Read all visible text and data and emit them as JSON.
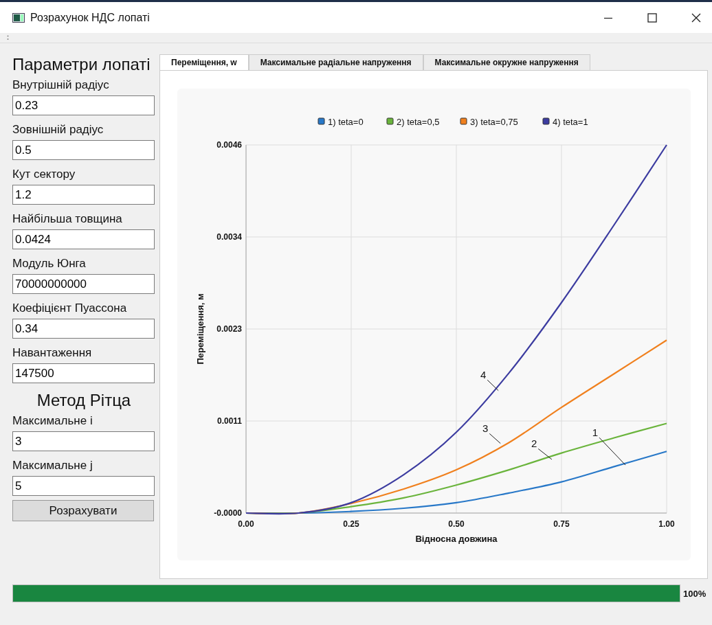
{
  "window": {
    "title": "Розрахунок НДС лопаті"
  },
  "left_panel": {
    "heading": "Параметри лопаті",
    "fields": [
      {
        "label": "Внутрішній радіус",
        "value": "0.23"
      },
      {
        "label": "Зовнішній радіус",
        "value": "0.5"
      },
      {
        "label": "Кут сектору",
        "value": "1.2"
      },
      {
        "label": "Найбільша товщина",
        "value": "0.0424"
      },
      {
        "label": "Модуль Юнга",
        "value": "70000000000"
      },
      {
        "label": "Коефіцієнт Пуассона",
        "value": "0.34"
      },
      {
        "label": "Навантаження",
        "value": "147500"
      }
    ],
    "method_heading": "Метод Рітца",
    "method_fields": [
      {
        "label": "Максимальне i",
        "value": "3"
      },
      {
        "label": "Максимальне j",
        "value": "5"
      }
    ],
    "calculate_button": "Розрахувати"
  },
  "tabs": [
    {
      "label": "Переміщення, w",
      "selected": true
    },
    {
      "label": "Максимальне радіальне напруження",
      "selected": false
    },
    {
      "label": "Максимальне окружне напруження",
      "selected": false
    }
  ],
  "plot": {
    "chart_data": {
      "type": "line",
      "xlabel": "Відносна довжина",
      "ylabel": "Переміщення, м",
      "x": [
        0,
        0.125,
        0.25,
        0.375,
        0.5,
        0.625,
        0.75,
        0.875,
        1
      ],
      "series": [
        {
          "name": "1) teta=0",
          "color": "#2878c8",
          "values": [
            0,
            0,
            2e-05,
            6e-05,
            0.00013,
            0.00025,
            0.00039,
            0.00058,
            0.00077
          ]
        },
        {
          "name": "2) teta=0,5",
          "color": "#6ab43c",
          "values": [
            0,
            0,
            8e-05,
            0.00019,
            0.00035,
            0.00054,
            0.00075,
            0.00094,
            0.00112
          ]
        },
        {
          "name": "3) teta=0,75",
          "color": "#f0801e",
          "values": [
            0,
            0,
            0.00012,
            0.0003,
            0.00054,
            0.00088,
            0.00132,
            0.00174,
            0.00216
          ]
        },
        {
          "name": "4) teta=1",
          "color": "#3c3ca0",
          "values": [
            0,
            0,
            0.00013,
            0.00048,
            0.00101,
            0.00175,
            0.00263,
            0.0036,
            0.0046
          ]
        }
      ],
      "grid": true,
      "legend": true,
      "xlim": [
        0,
        1
      ],
      "ylim": [
        0,
        0.0046
      ],
      "xticks": [
        {
          "value": 0,
          "label": "0.00"
        },
        {
          "value": 0.25,
          "label": "0.25"
        },
        {
          "value": 0.5,
          "label": "0.50"
        },
        {
          "value": 0.75,
          "label": "0.75"
        },
        {
          "value": 1,
          "label": "1.00"
        }
      ],
      "yticks": [
        {
          "value": 0,
          "label": "-0.0000"
        },
        {
          "value": 0.00115,
          "label": "0.0011"
        },
        {
          "value": 0.0023,
          "label": "0.0023"
        },
        {
          "value": 0.00345,
          "label": "0.0034"
        },
        {
          "value": 0.0046,
          "label": "0.0046"
        }
      ],
      "annotations": [
        "4",
        "3",
        "2",
        "1"
      ]
    }
  },
  "progress": {
    "level": 1,
    "reading": "100%"
  }
}
